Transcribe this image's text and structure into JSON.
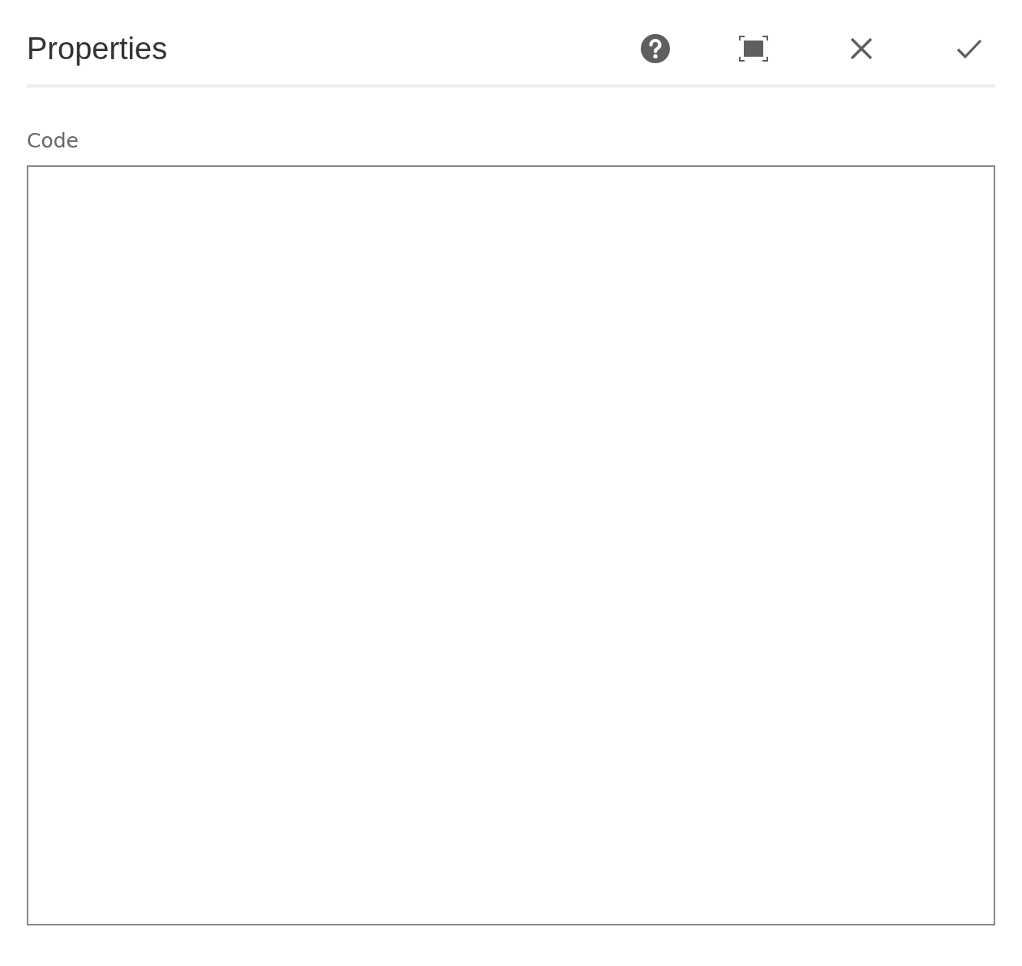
{
  "dialog": {
    "title": "Properties"
  },
  "actions": [
    {
      "kind": "help"
    },
    {
      "kind": "fullscreen"
    },
    {
      "kind": "cancel"
    },
    {
      "kind": "done"
    }
  ],
  "field": {
    "label": "Code"
  }
}
